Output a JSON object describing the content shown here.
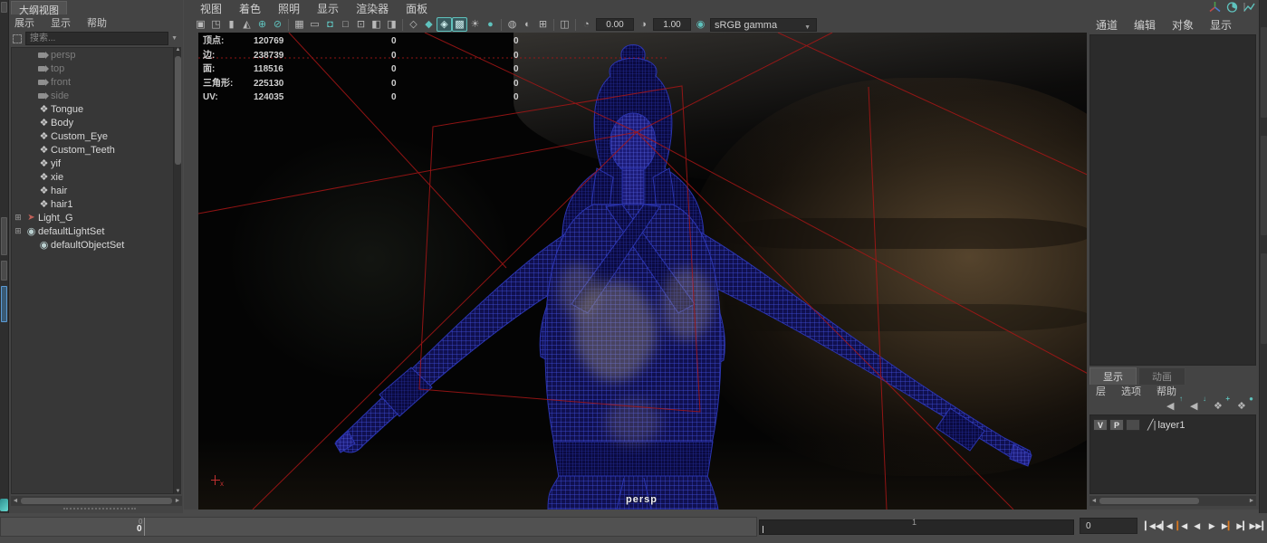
{
  "colors": {
    "accent_teal": "#5fc2bd",
    "accent_orange": "#d8771f",
    "wireframe_blue": "#4553e8",
    "red_wire": "#a81616",
    "panel_bg": "#444444",
    "recessed_bg": "#2b2b2b"
  },
  "ui_icons": {
    "scroll_up": "▲",
    "scroll_down": "▼",
    "scroll_left": "◄",
    "scroll_right": "►",
    "dropdown_arrow": "▼",
    "expander": "⊞",
    "mesh_glyph": "❖",
    "light_glyph": "➤",
    "set_glyph": "◉"
  },
  "outliner": {
    "title": "大纲视图",
    "menus": [
      "展示",
      "显示",
      "帮助"
    ],
    "search_placeholder": "搜索...",
    "items": [
      {
        "label": "persp",
        "icon": "camera-icon"
      },
      {
        "label": "top",
        "icon": "camera-icon"
      },
      {
        "label": "front",
        "icon": "camera-icon"
      },
      {
        "label": "side",
        "icon": "camera-icon"
      },
      {
        "label": "Tongue",
        "icon": "mesh-icon"
      },
      {
        "label": "Body",
        "icon": "mesh-icon"
      },
      {
        "label": "Custom_Eye",
        "icon": "mesh-icon"
      },
      {
        "label": "Custom_Teeth",
        "icon": "mesh-icon"
      },
      {
        "label": "yif",
        "icon": "mesh-icon"
      },
      {
        "label": "xie",
        "icon": "mesh-icon"
      },
      {
        "label": "hair",
        "icon": "mesh-icon"
      },
      {
        "label": "hair1",
        "icon": "mesh-icon"
      },
      {
        "label": "Light_G",
        "icon": "light-icon"
      },
      {
        "label": "defaultLightSet",
        "icon": "set-icon"
      },
      {
        "label": "defaultObjectSet",
        "icon": "set-icon"
      }
    ]
  },
  "viewport": {
    "menus": [
      "视图",
      "着色",
      "照明",
      "显示",
      "渲染器",
      "面板"
    ],
    "toolbar": {
      "icons": [
        {
          "name": "select-camera-icon",
          "glyph": "▣"
        },
        {
          "name": "camera-attributes-icon",
          "glyph": "◳"
        },
        {
          "name": "bookmark-icon",
          "glyph": "▮"
        },
        {
          "name": "image-plane-icon",
          "glyph": "◭"
        },
        {
          "name": "pan-zoom-icon",
          "glyph": "⊕"
        },
        {
          "name": "snap-icon",
          "glyph": "⊘"
        },
        {
          "name": "grid-icon",
          "glyph": "▦"
        },
        {
          "name": "film-gate-icon",
          "glyph": "▭"
        },
        {
          "name": "resolution-gate-icon",
          "glyph": "◘"
        },
        {
          "name": "gate-mask-icon",
          "glyph": "□"
        },
        {
          "name": "field-chart-icon",
          "glyph": "⊡"
        },
        {
          "name": "safe-action-icon",
          "glyph": "◧"
        },
        {
          "name": "safe-title-icon",
          "glyph": "◨"
        },
        {
          "name": "wireframe-icon",
          "glyph": "◇"
        },
        {
          "name": "shaded-icon",
          "glyph": "◆"
        },
        {
          "name": "textured-icon",
          "glyph": "◈"
        },
        {
          "name": "multisample-icon",
          "glyph": "▩"
        },
        {
          "name": "lights-icon",
          "glyph": "☀"
        },
        {
          "name": "shadows-icon",
          "glyph": "●"
        },
        {
          "name": "ao-icon",
          "glyph": "◍"
        },
        {
          "name": "motion-blur-icon",
          "glyph": "◐"
        },
        {
          "name": "isolate-select-icon",
          "glyph": "⊞"
        },
        {
          "name": "xray-icon",
          "glyph": "◫"
        },
        {
          "name": "exposure-icon",
          "glyph": "◔"
        },
        {
          "name": "gamma-icon",
          "glyph": "◑"
        },
        {
          "name": "view-transform-icon",
          "glyph": "◉"
        }
      ],
      "exposure_value": "0.00",
      "gamma_value": "1.00",
      "colorspace": "sRGB gamma"
    },
    "hud": {
      "rows": [
        {
          "label": "顶点:",
          "v1": "120769",
          "v2": "0",
          "v3": "0"
        },
        {
          "label": "边:",
          "v1": "238739",
          "v2": "0",
          "v3": "0"
        },
        {
          "label": "面:",
          "v1": "118516",
          "v2": "0",
          "v3": "0"
        },
        {
          "label": "三角形:",
          "v1": "225130",
          "v2": "0",
          "v3": "0"
        },
        {
          "label": "UV:",
          "v1": "124035",
          "v2": "0",
          "v3": "0"
        }
      ]
    },
    "camera_label": "persp",
    "axis_label": "x"
  },
  "right_panel": {
    "menus": [
      "通道",
      "编辑",
      "对象",
      "显示"
    ],
    "layer_editor": {
      "tabs": [
        "显示",
        "动画"
      ],
      "menus": [
        "层",
        "选项",
        "帮助"
      ],
      "icon_accents": {
        "up": "↑",
        "down": "↓",
        "add": "+",
        "new": "●",
        "base": "◀",
        "diamond": "❖"
      },
      "layer": {
        "visible": "V",
        "playback": "P",
        "glyph": "╱|",
        "name": "layer1"
      }
    }
  },
  "timeline": {
    "tick_label": "0",
    "playhead_label": "0",
    "range_end_label": "1",
    "frame_field": "0",
    "transport": {
      "b1": {
        "bar": "▎",
        "tri": "◀◀"
      },
      "b2": {
        "bar": "▎",
        "tri": "◀"
      },
      "b3": {
        "bar": "▎",
        "tri": "◀"
      },
      "b4": {
        "tri": "◀"
      },
      "b5": {
        "tri": "▶"
      },
      "b6": {
        "tri": "▶",
        "bar": "▎"
      },
      "b7": {
        "tri": "▶",
        "bar": "▎"
      },
      "b8": {
        "tri": "▶▶",
        "bar": "▎"
      }
    }
  }
}
